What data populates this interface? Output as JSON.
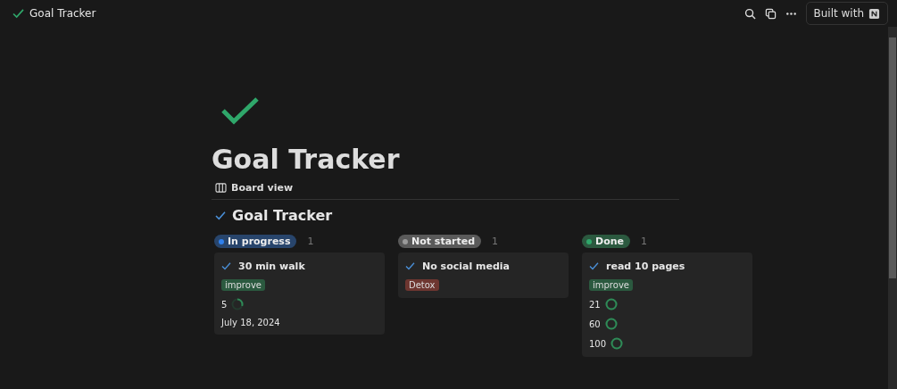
{
  "topbar": {
    "title": "Goal Tracker",
    "built_with": "Built with"
  },
  "page": {
    "title": "Goal Tracker",
    "view_tab": "Board view",
    "database_title": "Goal Tracker"
  },
  "columns": [
    {
      "status": "In progress",
      "color": "#2f80ed",
      "count": "1",
      "cards": [
        {
          "title": "30 min walk",
          "tag": {
            "label": "improve",
            "color": "#2b593f"
          },
          "progress": [
            {
              "value": "5",
              "level": 0.3
            }
          ],
          "date": "July 18, 2024"
        }
      ]
    },
    {
      "status": "Not started",
      "color": "#9b9b9b",
      "count": "1",
      "cards": [
        {
          "title": "No social media",
          "tag": {
            "label": "Detox",
            "color": "#6e3630"
          }
        }
      ]
    },
    {
      "status": "Done",
      "color": "#2fa76a",
      "count": "1",
      "cards": [
        {
          "title": "read 10 pages",
          "tag": {
            "label": "improve",
            "color": "#2b593f"
          },
          "progress": [
            {
              "value": "21",
              "level": 1
            },
            {
              "value": "60",
              "level": 1
            },
            {
              "value": "100",
              "level": 1
            }
          ]
        }
      ]
    }
  ]
}
